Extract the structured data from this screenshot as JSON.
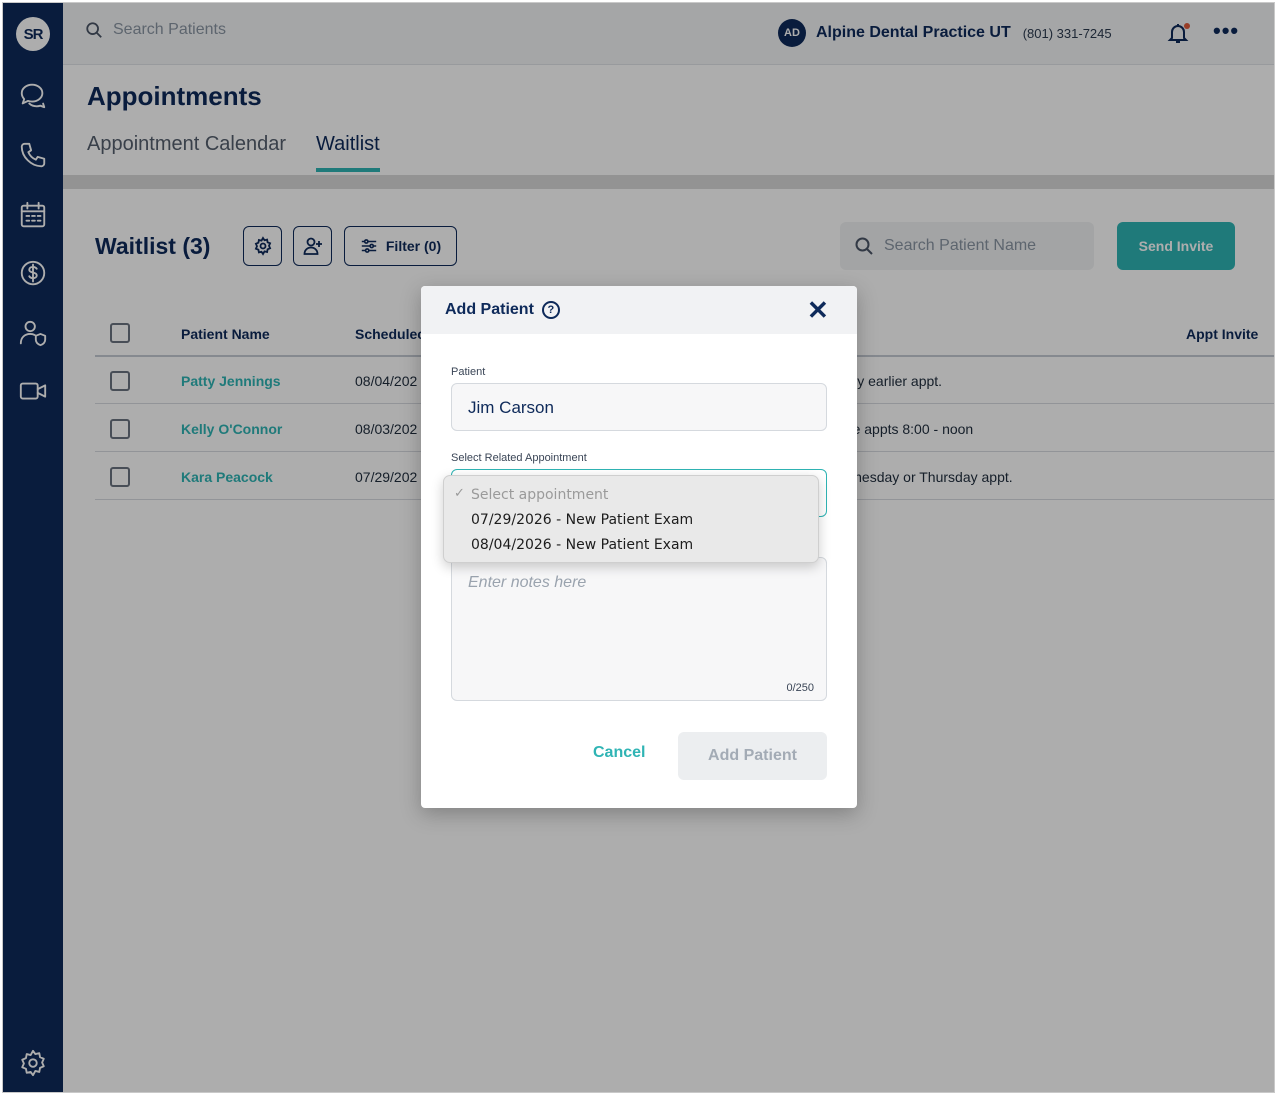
{
  "sidebar": {
    "logo": "SR",
    "icons": [
      "chat-icon",
      "phone-icon",
      "calendar-icon",
      "dollar-icon",
      "user-shield-icon",
      "video-icon",
      "gear-icon"
    ]
  },
  "topbar": {
    "search_placeholder": "Search Patients",
    "avatar_initials": "AD",
    "practice_name": "Alpine Dental Practice UT",
    "practice_phone": "(801) 331-7245"
  },
  "page": {
    "title": "Appointments",
    "tabs": [
      {
        "label": "Appointment Calendar",
        "active": false
      },
      {
        "label": "Waitlist",
        "active": true
      }
    ]
  },
  "waitlist": {
    "title": "Waitlist (3)",
    "filter_label": "Filter (0)",
    "search_placeholder": "Search Patient Name",
    "send_invite_label": "Send Invite",
    "columns": {
      "patient_name": "Patient Name",
      "scheduled": "Schedulec",
      "appt_invite": "Appt Invite"
    },
    "rows": [
      {
        "name": "Patty Jennings",
        "date": "08/04/202",
        "note": "e any earlier appt."
      },
      {
        "name": "Kelly O'Connor",
        "date": "08/03/202",
        "note": "nake appts 8:00 - noon"
      },
      {
        "name": "Kara Peacock",
        "date": "07/29/202",
        "note": "Vednesday or Thursday appt."
      }
    ]
  },
  "modal": {
    "title": "Add Patient",
    "help_glyph": "?",
    "close_glyph": "✕",
    "patient_label": "Patient",
    "patient_value": "Jim Carson",
    "related_label": "Select Related Appointment",
    "notes_placeholder": "Enter notes here",
    "notes_counter": "0/250",
    "cancel_label": "Cancel",
    "add_label": "Add Patient"
  },
  "dropdown": {
    "check_glyph": "✓",
    "placeholder": "Select appointment",
    "options": [
      "07/29/2026 - New Patient Exam",
      "08/04/2026 - New Patient Exam"
    ]
  },
  "colors": {
    "sidebar": "#0e2a5a",
    "accent": "#2fb4b4",
    "overlay": "rgba(0,0,0,0.32)"
  }
}
